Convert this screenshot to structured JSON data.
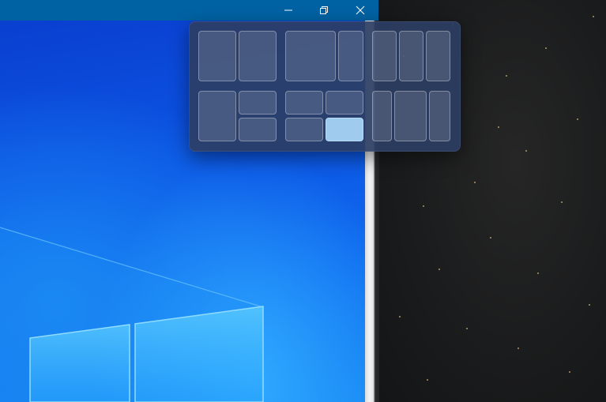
{
  "window": {
    "titlebar_color": "#0062a3",
    "buttons": [
      {
        "name": "minimize",
        "icon": "minimize-icon"
      },
      {
        "name": "restore",
        "icon": "restore-icon"
      },
      {
        "name": "close",
        "icon": "close-icon"
      }
    ]
  },
  "snap_layouts": {
    "flyout_color": "#2c3e64",
    "selected_zone_color": "#9ecbee",
    "layouts": [
      {
        "id": "two-equal",
        "zones": 2
      },
      {
        "id": "two-wide-narrow",
        "zones": 2
      },
      {
        "id": "three-columns",
        "zones": 3
      },
      {
        "id": "main-plus-two-stacked",
        "zones": 3
      },
      {
        "id": "four-quadrants",
        "zones": 4,
        "selected_zone": 4
      },
      {
        "id": "three-narrow-wide-narrow",
        "zones": 3
      }
    ]
  }
}
